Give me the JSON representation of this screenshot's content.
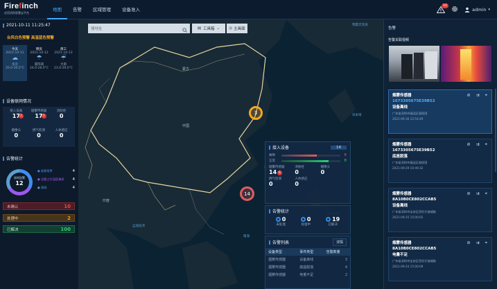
{
  "brand": {
    "name_white": "Fire",
    "name_red": "f",
    "name_rest": "inch",
    "subtitle": "应用消防智慧云平台"
  },
  "nav": [
    "地图",
    "告警",
    "区域管理",
    "设备准入"
  ],
  "header": {
    "badge": "10",
    "user": "admin"
  },
  "left": {
    "datetime": "2021-10-11 11:25:47",
    "warning": "台风白色预警 高温蓝色预警",
    "weather": [
      {
        "day": "今天",
        "date": "2021-10-11",
        "cond": "多云",
        "temp": "20.0-30.0°C"
      },
      {
        "day": "明天",
        "date": "2021-10-12",
        "cond": "雷阵雨",
        "temp": "24.0-28.0°C"
      },
      {
        "day": "周三",
        "date": "2021-10-13",
        "cond": "大雨",
        "temp": "23.0-29.0°C"
      }
    ],
    "device_title": "设备联网情况",
    "devices": [
      {
        "label": "接入设备",
        "value": "17",
        "badge": "7"
      },
      {
        "label": "烟雾传感器",
        "value": "17",
        "badge": "7"
      },
      {
        "label": "消防栓",
        "value": "0"
      },
      {
        "label": "摄像头",
        "value": "0"
      },
      {
        "label": "燃气检测",
        "value": "0"
      },
      {
        "label": "人体感应",
        "value": "0"
      }
    ],
    "alarm_title": "告警统计",
    "donut": {
      "label": "实时告警",
      "value": "12"
    },
    "legend": [
      {
        "label": "● 烟雾报警",
        "value": "4",
        "color": "#3f8ef0"
      },
      {
        "label": "● 设备工作温度偏离",
        "value": "4",
        "color": "#9b59f0"
      },
      {
        "label": "● 离线",
        "value": "4",
        "color": "#5aa0d0"
      }
    ],
    "status": [
      {
        "label": "未确认",
        "value": "10",
        "color": "#e74c3c",
        "bg": "rgba(120,30,35,.6)"
      },
      {
        "label": "处理中",
        "value": "2",
        "color": "#f39c12",
        "bg": "rgba(110,70,20,.6)"
      },
      {
        "label": "已解决",
        "value": "100",
        "color": "#2ecc71",
        "bg": "rgba(20,90,55,.6)"
      }
    ]
  },
  "map": {
    "search_placeholder": "搜地址",
    "layer_btn": "工具箱",
    "map_btn": "主画面",
    "clusters": [
      {
        "value": "3",
        "color": "#f5a623"
      },
      {
        "value": "14",
        "color": "#e05d5d"
      }
    ],
    "labels": [
      {
        "text": "鄂霍次克海"
      },
      {
        "text": "日本海"
      },
      {
        "text": "东海"
      },
      {
        "text": "南海"
      },
      {
        "text": "孟加拉湾"
      },
      {
        "text": "菲律宾海"
      },
      {
        "text": "中国"
      },
      {
        "text": "蒙古"
      },
      {
        "text": "印度"
      }
    ]
  },
  "access": {
    "title": "接入设备",
    "count": "14",
    "bars": [
      {
        "label": "故障",
        "value": "6",
        "fill": 0.6,
        "color": "#e05d5d"
      },
      {
        "label": "正常",
        "value": "8",
        "fill": 0.8,
        "color": "#2ecc71"
      }
    ],
    "grid": [
      {
        "label": "烟雾传感器",
        "value": "14",
        "badge": "6"
      },
      {
        "label": "消防栓",
        "value": "0"
      },
      {
        "label": "摄像头",
        "value": "0"
      },
      {
        "label": "燃气检测",
        "value": "0"
      },
      {
        "label": "人体感应",
        "value": "0"
      }
    ]
  },
  "stats": {
    "title": "告警统计",
    "items": [
      {
        "label": "未处理",
        "value": "0"
      },
      {
        "label": "处理中",
        "value": "0"
      },
      {
        "label": "已解决",
        "value": "19"
      }
    ]
  },
  "alarm_list": {
    "title": "告警列表",
    "btn": "详情",
    "headers": [
      "设备类型",
      "事件类型",
      "告警数量"
    ],
    "rows": [
      [
        "烟雾传感器",
        "设备离线",
        "3"
      ],
      [
        "烟雾传感器",
        "底座脱落",
        "4"
      ],
      [
        "烟雾传感器",
        "电量不足",
        "2"
      ]
    ]
  },
  "right": {
    "title": "告警",
    "sub": "告警关联视频",
    "alarms": [
      {
        "type": "烟雾传感器",
        "id": "1673305675E39B52",
        "event": "设备离线",
        "addr": "广东省深圳市福田区福保国",
        "time": "2021-09-30 12:54:49"
      },
      {
        "type": "烟雾传感器",
        "id": "1673305675E39B52",
        "event": "底座脱落",
        "addr": "广东省深圳市福田区福保国",
        "time": "2021-09-29 10:49:32"
      },
      {
        "type": "烟雾传感器",
        "id": "8A10B0CE802CCAB5",
        "event": "设备离线",
        "addr": "广东省深圳市宝安区西坝大道辅路",
        "time": "2021-09-25 15:00:02"
      },
      {
        "type": "烟雾传感器",
        "id": "8A10B0CE802CCAB5",
        "event": "电量不足",
        "addr": "广东省深圳市宝安区西坝大道辅路",
        "time": "2021-09-24 15:00:09"
      }
    ]
  }
}
